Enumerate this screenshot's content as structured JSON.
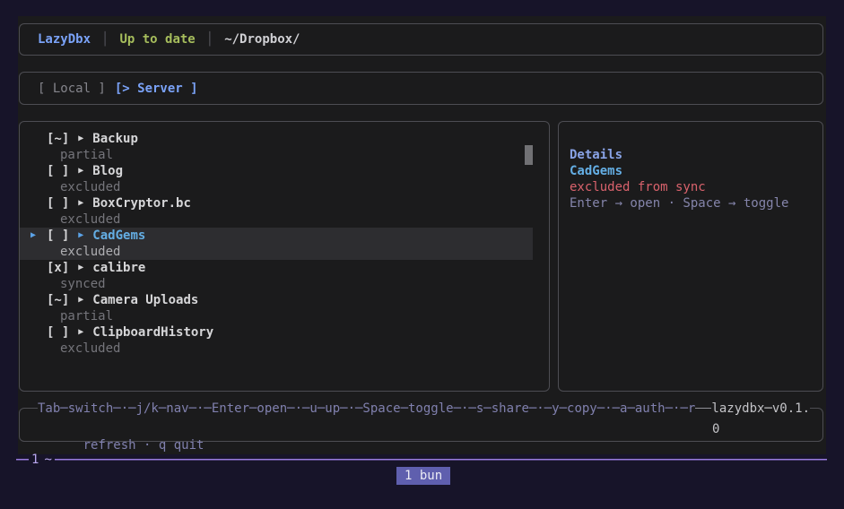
{
  "header": {
    "app_name": "LazyDbx",
    "separator": "│",
    "sync_status": "Up to date",
    "path": "~/Dropbox/"
  },
  "tabs": {
    "local_label": "[ Local ]",
    "server_label": "[> Server ]"
  },
  "file_list": {
    "pointer_glyph": "▶",
    "arrow_glyph": "▶",
    "items": [
      {
        "checkbox": "[~]",
        "name": "Backup",
        "status": "partial",
        "selected": false
      },
      {
        "checkbox": "[ ]",
        "name": "Blog",
        "status": "excluded",
        "selected": false
      },
      {
        "checkbox": "[ ]",
        "name": "BoxCryptor.bc",
        "status": "excluded",
        "selected": false
      },
      {
        "checkbox": "[ ]",
        "name": "CadGems",
        "status": "excluded",
        "selected": true
      },
      {
        "checkbox": "[x]",
        "name": "calibre",
        "status": "synced",
        "selected": false
      },
      {
        "checkbox": "[~]",
        "name": "Camera Uploads",
        "status": "partial",
        "selected": false
      },
      {
        "checkbox": "[ ]",
        "name": "ClipboardHistory",
        "status": "excluded",
        "selected": false
      }
    ]
  },
  "details": {
    "title": "Details",
    "name": "CadGems",
    "status": "excluded from sync",
    "hint": "Enter → open · Space → toggle"
  },
  "keybind_bar": {
    "line1_left": "Tab─switch─·─j/k─nav─·─Enter─open─·─u─up─·─Space─toggle─·─s─share─·─y─copy─·─a─auth─·─r",
    "line2_left": "refresh · q quit",
    "line1_right": "lazydbx─v0.1.",
    "line2_right": "0"
  },
  "terminal": {
    "pane_index": "1",
    "pane_title": "~",
    "tab_badge": "1 bun"
  },
  "colors": {
    "terminal_bg": "#171429",
    "app_bg": "#1b1b1c",
    "border": "#4d4d53",
    "accent_blue": "#7aa2f7",
    "selected_blue": "#64aee4",
    "green": "#a6bd5c",
    "red": "#d9626c",
    "muted_indigo": "#8080ae",
    "selection_bg": "#2d2d30",
    "pane_line_purple": "#9a7ce0",
    "badge_bg": "#5f5fae"
  }
}
